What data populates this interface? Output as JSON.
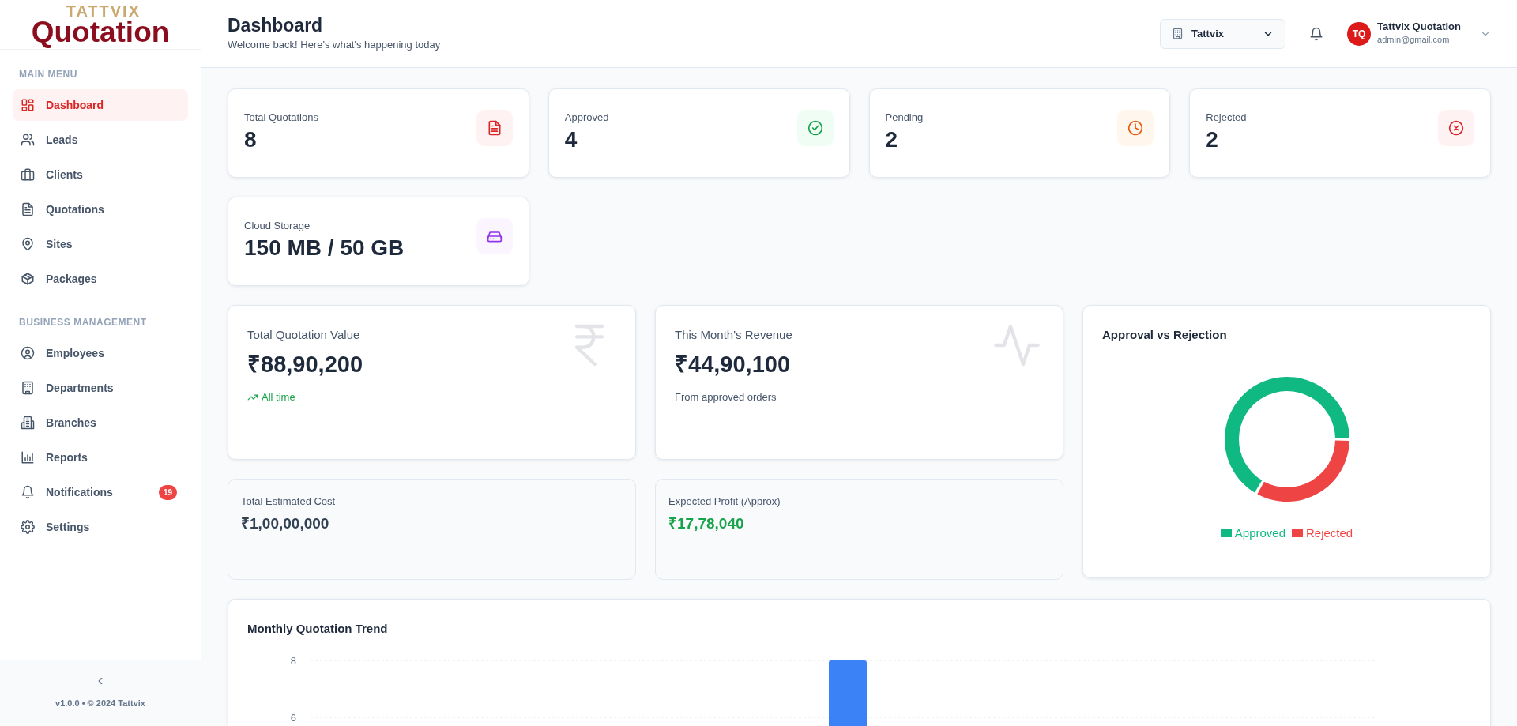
{
  "logo": {
    "top": "TATTVIX",
    "main": "Quotation"
  },
  "sidebar": {
    "sections": [
      {
        "title": "MAIN MENU",
        "items": [
          {
            "label": "Dashboard",
            "selected": true
          },
          {
            "label": "Leads",
            "selected": false
          },
          {
            "label": "Clients",
            "selected": false
          },
          {
            "label": "Quotations",
            "selected": false
          },
          {
            "label": "Sites",
            "selected": false
          },
          {
            "label": "Packages",
            "selected": false
          }
        ]
      },
      {
        "title": "BUSINESS MANAGEMENT",
        "items": [
          {
            "label": "Employees",
            "selected": false
          },
          {
            "label": "Departments",
            "selected": false
          },
          {
            "label": "Branches",
            "selected": false
          },
          {
            "label": "Reports",
            "selected": false
          },
          {
            "label": "Notifications",
            "selected": false,
            "badge": "19"
          },
          {
            "label": "Settings",
            "selected": false
          }
        ]
      }
    ],
    "collapse": "‹",
    "footer": "v1.0.0 • © 2024 Tattvix"
  },
  "header": {
    "title": "Dashboard",
    "subtitle": "Welcome back! Here's what's happening today",
    "company": "Tattvix",
    "user": {
      "initials": "TQ",
      "name": "Tattvix Quotation",
      "email": "admin@gmail.com"
    }
  },
  "stats": [
    {
      "label": "Total Quotations",
      "value": "8"
    },
    {
      "label": "Approved",
      "value": "4"
    },
    {
      "label": "Pending",
      "value": "2"
    },
    {
      "label": "Rejected",
      "value": "2"
    },
    {
      "label": "Cloud Storage",
      "value": "150 MB / 50 GB"
    }
  ],
  "value_cards": [
    {
      "label": "Total Quotation Value",
      "value": "₹88,90,200",
      "note": "All time",
      "kind": "trend"
    },
    {
      "label": "This Month's Revenue",
      "value": "₹44,90,100",
      "note": "From approved orders",
      "kind": "plain"
    }
  ],
  "cost_cards": [
    {
      "label": "Total Estimated Cost",
      "value": "₹1,00,00,000",
      "kind": "plain"
    },
    {
      "label": "Expected Profit (Approx)",
      "value": "₹17,78,040",
      "kind": "profit"
    }
  ],
  "approval": {
    "title": "Approval vs Rejection",
    "chart_data": {
      "type": "donut",
      "categories": [
        "Approved",
        "Rejected"
      ],
      "values": [
        66.7,
        33.3
      ]
    }
  },
  "trend": {
    "title": "Monthly Quotation Trend",
    "chart_data": {
      "type": "bar",
      "ylim": [
        0,
        8
      ],
      "yticks": [
        6,
        8
      ],
      "values": [
        8
      ]
    }
  }
}
